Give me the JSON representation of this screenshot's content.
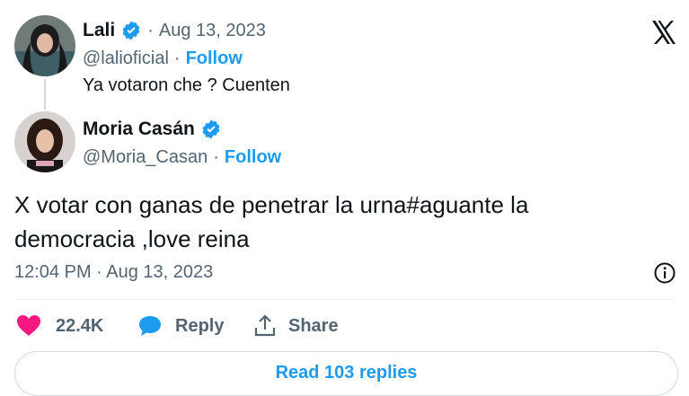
{
  "reply_parent": {
    "name": "Lali",
    "handle": "@lalioficial",
    "separator": "·",
    "date": "Aug 13, 2023",
    "follow_label": "Follow",
    "text": "Ya votaron che ? Cuenten"
  },
  "tweet": {
    "name": "Moria Casán",
    "handle": "@Moria_Casan",
    "separator": "·",
    "follow_label": "Follow",
    "text_line1": "X votar con ganas de penetrar la urna#aguante la",
    "text_line2": "democracia ,love reina",
    "timestamp": "12:04 PM · Aug 13, 2023"
  },
  "actions": {
    "likes": "22.4K",
    "reply_label": "Reply",
    "share_label": "Share"
  },
  "read_replies_label": "Read 103 replies",
  "icons": {
    "platform": "x-logo-icon",
    "verified": "verified-badge-icon",
    "info": "info-icon",
    "like": "heart-icon",
    "reply": "speech-bubble-icon",
    "share": "share-icon"
  },
  "colors": {
    "accent": "#1d9bf0",
    "like": "#f91880",
    "text": "#0f1419",
    "muted": "#536471"
  }
}
